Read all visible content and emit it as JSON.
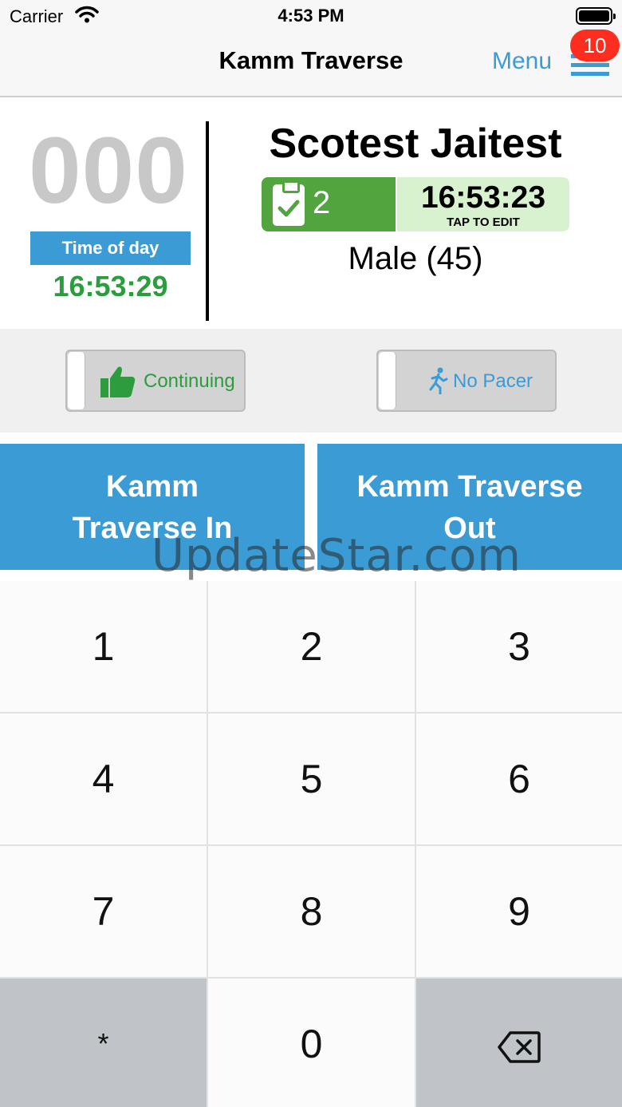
{
  "status_bar": {
    "carrier": "Carrier",
    "time": "4:53 PM"
  },
  "nav": {
    "title": "Kamm Traverse",
    "menu_label": "Menu",
    "badge_count": "10"
  },
  "runner": {
    "bib": "000",
    "time_of_day_label": "Time of day",
    "time_of_day": "16:53:29",
    "name": "Scotest Jaitest",
    "check_count": "2",
    "checkin_time": "16:53:23",
    "tap_to_edit": "TAP TO EDIT",
    "gender_age": "Male (45)"
  },
  "toggles": {
    "continuing": "Continuing",
    "pacer": "No Pacer"
  },
  "direction": {
    "in_line1": "Kamm",
    "in_line2": "Traverse In",
    "out_line1": "Kamm Traverse",
    "out_line2": "Out"
  },
  "watermark": "UpdateStar.com",
  "keypad": {
    "keys": [
      "1",
      "2",
      "3",
      "4",
      "5",
      "6",
      "7",
      "8",
      "9",
      "*",
      "0"
    ]
  },
  "colors": {
    "accent_blue": "#3a9bd5",
    "green": "#52a43f",
    "badge_red": "#fd2e1f"
  }
}
